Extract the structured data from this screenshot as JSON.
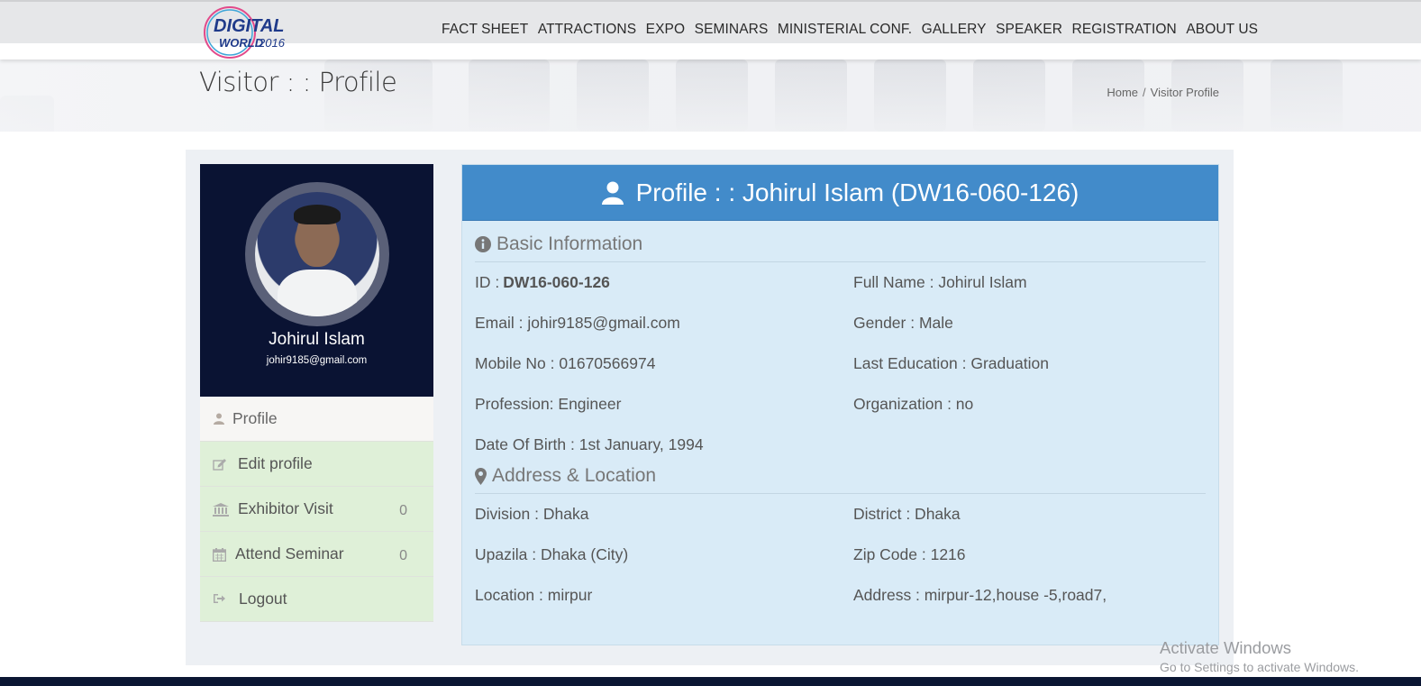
{
  "brand": {
    "logo_line1": "DIGITAL",
    "logo_line2": "WORLD",
    "logo_year": "2016"
  },
  "nav": [
    "FACT SHEET",
    "ATTRACTIONS",
    "EXPO",
    "SEMINARS",
    "MINISTERIAL CONF.",
    "GALLERY",
    "SPEAKER",
    "REGISTRATION",
    "ABOUT US"
  ],
  "page": {
    "title": "Visitor : : Profile",
    "breadcrumb_home": "Home",
    "breadcrumb_sep": "/",
    "breadcrumb_current": "Visitor Profile"
  },
  "sidebar": {
    "name": "Johirul Islam",
    "email": "johir9185@gmail.com",
    "items": [
      {
        "label": "Profile",
        "icon": "user-icon"
      },
      {
        "label": "Edit profile",
        "icon": "edit-icon"
      },
      {
        "label": "Exhibitor Visit",
        "icon": "bank-icon",
        "count": "0"
      },
      {
        "label": "Attend Seminar",
        "icon": "calendar-icon",
        "count": "0"
      },
      {
        "label": "Logout",
        "icon": "sign-out-icon"
      }
    ]
  },
  "profile": {
    "header": "Profile : : Johirul Islam (DW16-060-126)",
    "basic_title": "Basic Information",
    "id_label": "ID :",
    "id_value": "DW16-060-126",
    "full_name": "Full Name : Johirul Islam",
    "email": "Email : johir9185@gmail.com",
    "gender": "Gender : Male",
    "mobile": "Mobile No : 01670566974",
    "education": "Last Education : Graduation",
    "profession": "Profession: Engineer",
    "organization": "Organization : no",
    "dob": "Date Of Birth : 1st January, 1994",
    "address_title": "Address & Location",
    "division": "Division : Dhaka",
    "district": "District : Dhaka",
    "upazila": "Upazila : Dhaka (City)",
    "zip": "Zip Code : 1216",
    "location": "Location : mirpur",
    "address": "Address : mirpur-12,house -5,road7,"
  },
  "watermark": {
    "line1": "Activate Windows",
    "line2": "Go to Settings to activate Windows."
  },
  "colors": {
    "nav_bg": "#e6e7e9",
    "sidebar_head": "#0a1333",
    "header_blue": "#428bca",
    "panel_bg": "#d9ebf7",
    "menu_green": "#dff0d8"
  }
}
